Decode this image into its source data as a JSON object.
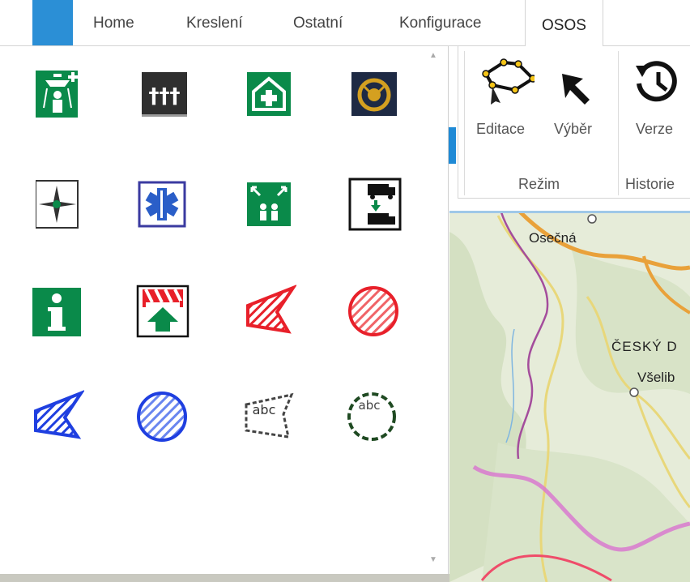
{
  "ribbon": {
    "tabs": [
      {
        "label": "Home"
      },
      {
        "label": "Kreslení"
      },
      {
        "label": "Ostatní"
      },
      {
        "label": "Konfigurace"
      },
      {
        "label": "OSOS",
        "active": true
      }
    ],
    "groups": {
      "rezim": {
        "label": "Režim",
        "buttons": [
          {
            "label": "Editace",
            "icon": "polygon-edit-icon"
          },
          {
            "label": "Výběr",
            "icon": "pointer-icon"
          }
        ]
      },
      "historie": {
        "label": "Historie",
        "buttons": [
          {
            "label": "Verze",
            "icon": "history-icon"
          }
        ]
      }
    }
  },
  "symbols": [
    {
      "name": "emergency-shower-icon"
    },
    {
      "name": "cemetery-icon"
    },
    {
      "name": "first-aid-shelter-icon"
    },
    {
      "name": "emblem-badge-icon"
    },
    {
      "name": "compass-star-icon"
    },
    {
      "name": "star-of-life-icon"
    },
    {
      "name": "assembly-point-icon"
    },
    {
      "name": "truck-transfer-icon"
    },
    {
      "name": "information-icon"
    },
    {
      "name": "barrier-arrow-icon"
    },
    {
      "name": "red-hatched-polygon-icon"
    },
    {
      "name": "red-hatched-circle-icon"
    },
    {
      "name": "blue-hatched-polygon-icon"
    },
    {
      "name": "blue-hatched-circle-icon"
    },
    {
      "name": "text-polygon-icon",
      "text": "abc"
    },
    {
      "name": "text-circle-icon",
      "text": "abc"
    }
  ],
  "map": {
    "labels": [
      {
        "text": "Osečná"
      },
      {
        "text": "ČESKÝ D"
      },
      {
        "text": "Všelib"
      }
    ]
  },
  "colors": {
    "accent": "#2b8fd6",
    "safety_green": "#0a8a4a",
    "hatch_red": "#e8202a",
    "hatch_blue": "#1f3fe0"
  }
}
